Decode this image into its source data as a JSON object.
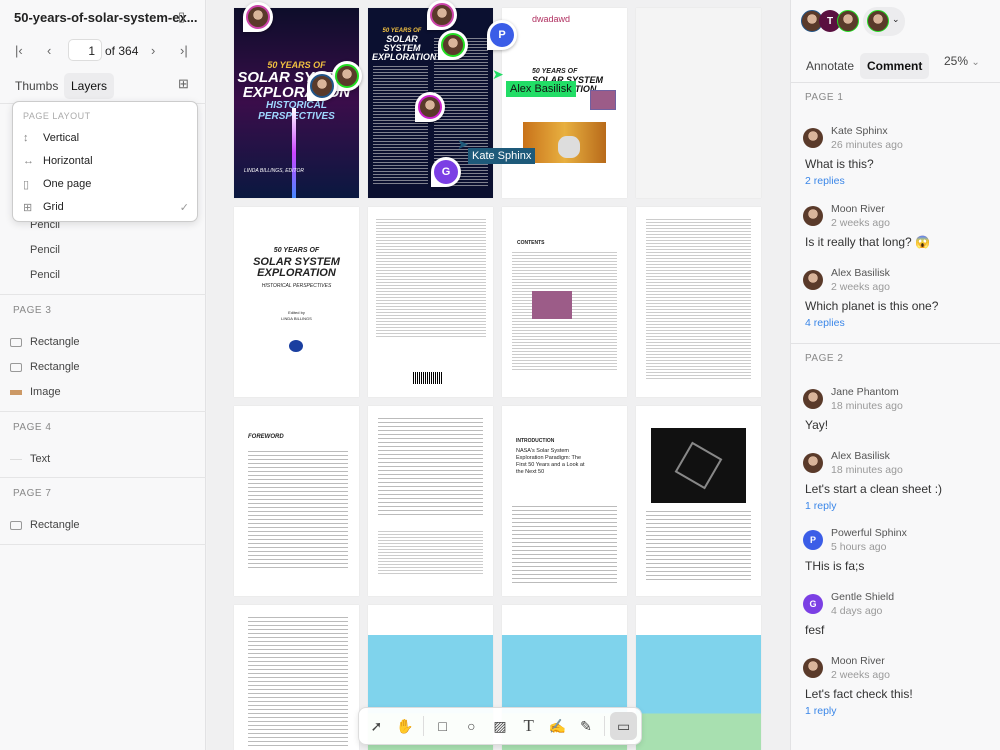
{
  "sidebar": {
    "doc_title": "50-years-of-solar-system-ex...",
    "page_current": "1",
    "page_total": "of 364",
    "tabs": [
      "Thumbs",
      "Layers"
    ],
    "menu": {
      "header": "PAGE LAYOUT",
      "items": [
        "Vertical",
        "Horizontal",
        "One page",
        "Grid"
      ],
      "selected": "Grid"
    },
    "layers": [
      {
        "section": null,
        "items": [
          "Pencil",
          "Pencil",
          "Pencil"
        ]
      },
      {
        "section": "PAGE 3",
        "items": [
          "Rectangle",
          "Rectangle",
          "Image"
        ]
      },
      {
        "section": "PAGE 4",
        "items": [
          "Text"
        ]
      },
      {
        "section": "PAGE 7",
        "items": [
          "Rectangle"
        ]
      }
    ]
  },
  "pages": {
    "cover_years": "50 YEARS OF",
    "cover_title": "SOLAR SYSTEM EXPLORATION",
    "cover_sub": "HISTORICAL PERSPECTIVES",
    "cover_editor": "LINDA BILLINGS, EDITOR",
    "page3_text": "dwadawd",
    "title_edited": "Edited by",
    "title_editor": "LINDA BILLINGS",
    "contents": "CONTENTS",
    "foreword": "FOREWORD",
    "intro": "INTRODUCTION",
    "intro_title": "NASA's Solar System Exploration Paradigm: The First 50 Years and a Look at the Next 50"
  },
  "cursors": [
    {
      "name": "Alex Basilisk",
      "color": "#22dd66"
    },
    {
      "name": "Kate Sphinx",
      "color": "#1e5a7a"
    }
  ],
  "pins": [
    "P",
    "G"
  ],
  "toolbar": [
    "select-icon",
    "hand-icon",
    "rectangle-icon",
    "circle-icon",
    "image-icon",
    "text-icon",
    "highlighter-icon",
    "pencil-icon",
    "comment-icon"
  ],
  "header": {
    "avatars": [
      "T"
    ],
    "modes": [
      "Annotate",
      "Comment"
    ],
    "active_mode": "Comment",
    "zoom": "25%"
  },
  "comments": [
    {
      "section": "PAGE 1",
      "items": [
        {
          "name": "Kate Sphinx",
          "time": "26 minutes ago",
          "text": "What is this?",
          "replies": "2 replies"
        },
        {
          "name": "Moon River",
          "time": "2 weeks ago",
          "text": "Is it really that long? 😱",
          "replies": null
        },
        {
          "name": "Alex Basilisk",
          "time": "2 weeks ago",
          "text": "Which planet is this one?",
          "replies": "4 replies"
        }
      ]
    },
    {
      "section": "PAGE 2",
      "items": [
        {
          "name": "Jane Phantom",
          "time": "18 minutes ago",
          "text": "Yay!",
          "replies": null
        },
        {
          "name": "Alex Basilisk",
          "time": "18 minutes ago",
          "text": "Let's start a clean sheet :)",
          "replies": "1 reply"
        },
        {
          "name": "Powerful Sphinx",
          "time": "5 hours ago",
          "text": "THis is fa;s",
          "replies": null,
          "initial": "P",
          "color": "#3b5de7"
        },
        {
          "name": "Gentle Shield",
          "time": "4 days ago",
          "text": "fesf",
          "replies": null,
          "initial": "G",
          "color": "#7b3fe4"
        },
        {
          "name": "Moon River",
          "time": "2 weeks ago",
          "text": "Let's fact check this!",
          "replies": "1 reply"
        }
      ]
    }
  ]
}
